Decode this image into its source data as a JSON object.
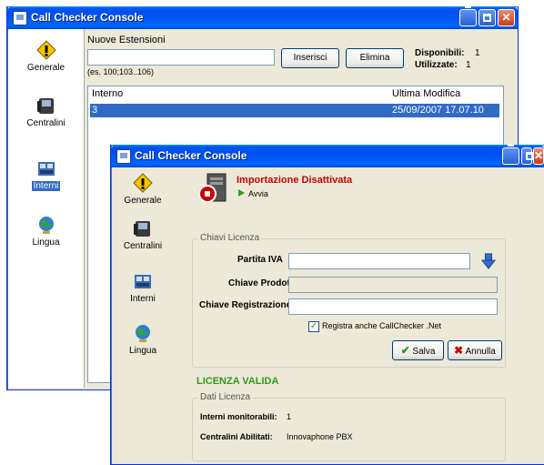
{
  "back_window": {
    "title": "Call Checker Console",
    "sidebar": [
      {
        "label": "Generale",
        "icon": "general-settings-icon",
        "selected": false
      },
      {
        "label": "Centralini",
        "icon": "pbx-phone-icon",
        "selected": false
      },
      {
        "label": "Interni",
        "icon": "extensions-icon",
        "selected": true
      },
      {
        "label": "Lingua",
        "icon": "globe-icon",
        "selected": false
      }
    ],
    "new_ext_label": "Nuove Estensioni",
    "new_ext_value": "",
    "example_hint": "(es. 100;103..106)",
    "insert_button": "Inserisci",
    "delete_button": "Elimina",
    "available_label": "Disponibili:",
    "available_value": "1",
    "used_label": "Utilizzate:",
    "used_value": "1",
    "columns": [
      "Interno",
      "Ultima Modifica"
    ],
    "rows": [
      {
        "interno": "3",
        "modifica": "25/09/2007 17.07.10",
        "selected": true
      }
    ]
  },
  "front_window": {
    "title": "Call Checker Console",
    "sidebar": [
      {
        "label": "Generale",
        "icon": "general-settings-icon"
      },
      {
        "label": "Centralini",
        "icon": "pbx-phone-icon"
      },
      {
        "label": "Interni",
        "icon": "extensions-icon"
      },
      {
        "label": "Lingua",
        "icon": "globe-icon"
      }
    ],
    "import_status": "Importazione Disattivata",
    "start_link": "Avvia",
    "license_keys_group": "Chiavi Licenza",
    "partita_iva_label": "Partita IVA",
    "partita_iva_value": "",
    "product_key_label": "Chiave Prodotto",
    "product_key_value": "",
    "registration_key_label": "Chiave Registrazione",
    "registration_key_value": "",
    "register_checkbox_label": "Registra anche CallChecker .Net",
    "register_checked": true,
    "save_button": "Salva",
    "cancel_button": "Annulla",
    "license_status": "LICENZA VALIDA",
    "license_data_group": "Dati Licenza",
    "monitorable_label": "Interni monitorabili:",
    "monitorable_value": "1",
    "enabled_pbx_label": "Centralini Abilitati:",
    "enabled_pbx_value": "Innovaphone PBX"
  },
  "colors": {
    "titlebar_blue": "#0053ee",
    "selection_blue": "#316ac5",
    "status_red": "#cc0000",
    "status_green": "#2e9a1e",
    "window_bg": "#ece9d8"
  }
}
